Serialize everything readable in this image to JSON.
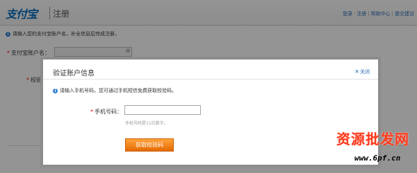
{
  "header": {
    "logo_text": "支付宝",
    "page_heading": "注册",
    "links": [
      "登录",
      "注册",
      "帮助中心",
      "提交建议"
    ]
  },
  "page": {
    "info_text": "请输入您的支付宝账户名，补全信息后完成注册。",
    "account_label": "支付宝账户名：",
    "verify_label": "校验"
  },
  "modal": {
    "title": "验证账户信息",
    "close_label": "关闭",
    "info_text": "请输入手机号码，您可通过手机短信免费获取校验码。",
    "phone_label": "手机号码：",
    "phone_value": "",
    "phone_hint": "手机号码是11位数字。",
    "get_code_button": "获取校验码"
  },
  "watermark": {
    "text": "资源批发网",
    "url": "www.6pf.cn"
  },
  "colors": {
    "link": "#2a6db6",
    "button": "#f08a1c",
    "watermark": "#ff3a1e"
  }
}
